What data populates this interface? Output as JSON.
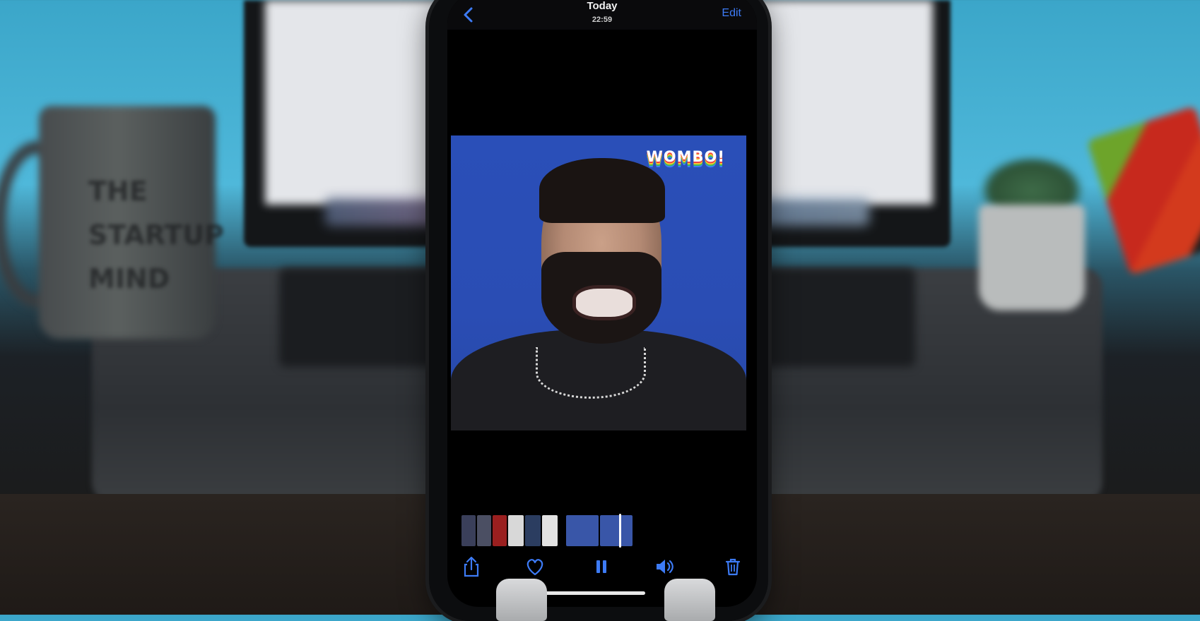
{
  "background": {
    "mug_text": "THE STARTUP MIND"
  },
  "nav": {
    "title": "Today",
    "time": "22:59",
    "edit_label": "Edit"
  },
  "video": {
    "watermark": "WOMBO!"
  },
  "toolbar": {
    "icons": [
      "share-icon",
      "heart-icon",
      "pause-icon",
      "speaker-icon",
      "trash-icon"
    ]
  },
  "colors": {
    "accent": "#3d7bf6",
    "video_bg": "#2a4fb8"
  }
}
